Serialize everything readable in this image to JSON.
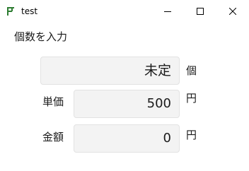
{
  "window": {
    "title": "test",
    "icon": "app-icon",
    "controls": {
      "minimize_icon": "minimize-icon",
      "maximize_icon": "maximize-icon",
      "close_icon": "close-icon"
    }
  },
  "form": {
    "prompt": "個数を入力",
    "quantity": {
      "value": "未定",
      "unit": "個"
    },
    "price": {
      "label": "単価",
      "value": "500",
      "unit": "円"
    },
    "amount": {
      "label": "金額",
      "value": "0",
      "unit": "円"
    }
  }
}
